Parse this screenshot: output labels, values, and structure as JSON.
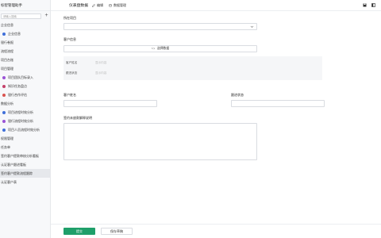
{
  "sidebar": {
    "app_title": "标智管理助手",
    "search_placeholder": "请输入搜索",
    "add_label": "+",
    "items": [
      {
        "label": "企业信息",
        "level": 0,
        "dot": null
      },
      {
        "label": "企业信息",
        "level": 1,
        "dot": "#3f6fd9"
      },
      {
        "label": "银行卷报",
        "level": 0,
        "dot": null
      },
      {
        "label": "流程流程",
        "level": 0,
        "dot": null
      },
      {
        "label": "项目台账",
        "level": 0,
        "dot": null
      },
      {
        "label": "项目管理",
        "level": 0,
        "dot": null
      },
      {
        "label": "项目团队目标录入",
        "level": 1,
        "dot": "#9a53d6"
      },
      {
        "label": "知识任务盘点",
        "level": 1,
        "dot": "#c4406a"
      },
      {
        "label": "银行合作评估",
        "level": 1,
        "dot": "#d9534f"
      },
      {
        "label": "数据分析",
        "level": 0,
        "dot": null
      },
      {
        "label": "项目进程时效分析",
        "level": 1,
        "dot": "#3f6fd9"
      },
      {
        "label": "银行流程时效分析",
        "level": 1,
        "dot": "#9a53d6"
      },
      {
        "label": "项目人员流程时效分析",
        "level": 1,
        "dot": "#3f6fd9"
      },
      {
        "label": "权限管理",
        "level": 0,
        "dot": null
      },
      {
        "label": "任务单",
        "level": 0,
        "dot": null
      },
      {
        "label": "签约客户提款审核分析看板",
        "level": 0,
        "dot": null
      },
      {
        "label": "认证客户跟进看板",
        "level": 0,
        "dot": null
      },
      {
        "label": "签约客户提款流程跟踪",
        "level": 0,
        "dot": null,
        "active": true
      },
      {
        "label": "认证客户表",
        "level": 0,
        "dot": null
      }
    ]
  },
  "toolbar": {
    "title": "仪表盘数据",
    "edit_label": "编辑",
    "manage_label": "数据管理"
  },
  "form": {
    "project_label": "所在项目",
    "customer_info_label": "客户信息",
    "pick_button_label": "选择数据",
    "customer_name_label": "客户姓名",
    "follow_status_label": "跟进状态",
    "empty_value": "显示内容",
    "customer_name_field_label": "客户姓名",
    "follow_status_field_label": "跟进状态",
    "notes_label": "签约未放款解释说明"
  },
  "footer": {
    "submit_label": "提交",
    "save_draft_label": "保存草稿"
  },
  "colors": {
    "primary": "#1f9f6a"
  }
}
